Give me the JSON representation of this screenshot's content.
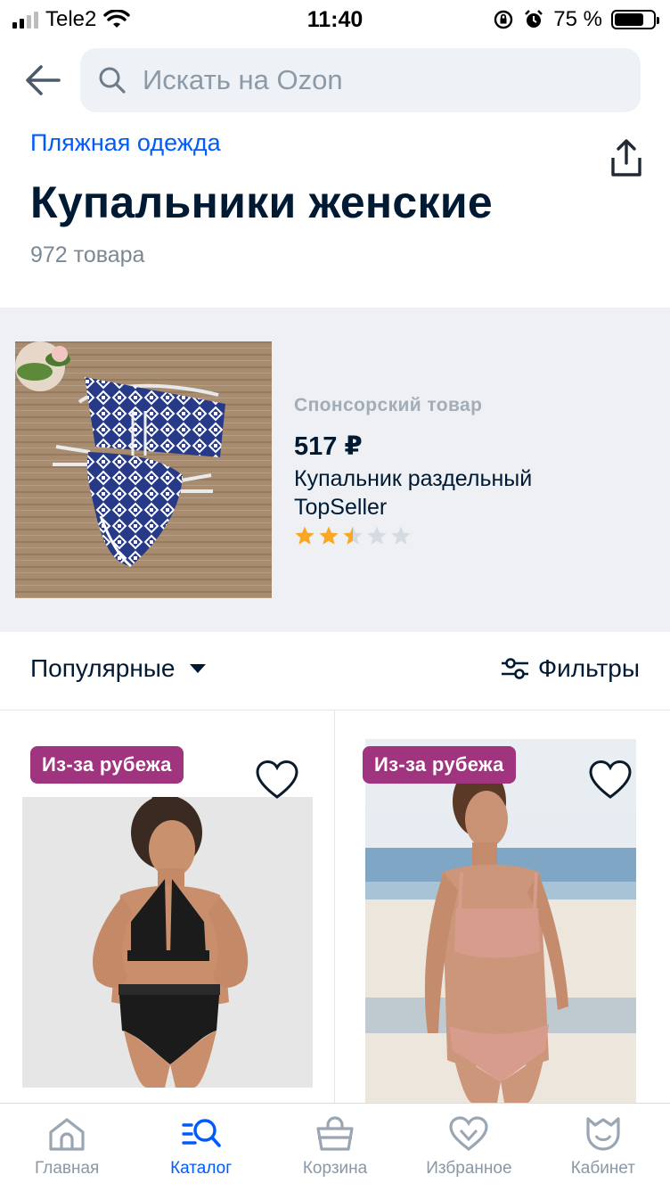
{
  "status_bar": {
    "carrier": "Tele2",
    "time": "11:40",
    "battery": "75 %"
  },
  "search": {
    "placeholder": "Искать на Ozon"
  },
  "breadcrumb": "Пляжная одежда",
  "title": "Купальники женские",
  "item_count": "972 товара",
  "sponsored": {
    "label": "Спонсорский товар",
    "price": "517 ₽",
    "name": "Купальник раздельный TopSeller",
    "rating": 2.5,
    "rating_max": 5
  },
  "toolbar": {
    "sort_label": "Популярные",
    "filter_label": "Фильтры"
  },
  "products": [
    {
      "badge": "Из-за рубежа",
      "favorite": false
    },
    {
      "badge": "Из-за рубежа",
      "favorite": false
    }
  ],
  "bottom_nav": [
    {
      "label": "Главная",
      "icon": "home-icon",
      "active": false
    },
    {
      "label": "Каталог",
      "icon": "catalog-icon",
      "active": true
    },
    {
      "label": "Корзина",
      "icon": "cart-icon",
      "active": false
    },
    {
      "label": "Избранное",
      "icon": "heart-icon",
      "active": false
    },
    {
      "label": "Кабинет",
      "icon": "profile-icon",
      "active": false
    }
  ],
  "colors": {
    "accent": "#005bff",
    "badge": "#a0347f",
    "star": "#f9a825",
    "text": "#001a34"
  }
}
